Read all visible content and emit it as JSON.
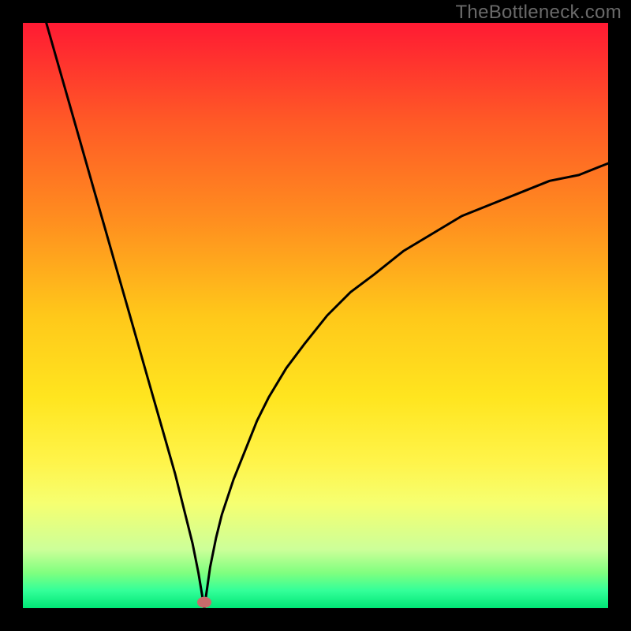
{
  "watermark": "TheBottleneck.com",
  "chart_data": {
    "type": "line",
    "title": "",
    "xlabel": "",
    "ylabel": "",
    "xlim": [
      0,
      100
    ],
    "ylim": [
      0,
      100
    ],
    "gradient_stops": [
      {
        "offset": 0.0,
        "color": "#ff1a33"
      },
      {
        "offset": 0.17,
        "color": "#ff5a26"
      },
      {
        "offset": 0.34,
        "color": "#ff8f1f"
      },
      {
        "offset": 0.5,
        "color": "#ffc81a"
      },
      {
        "offset": 0.64,
        "color": "#ffe51f"
      },
      {
        "offset": 0.75,
        "color": "#fff44a"
      },
      {
        "offset": 0.82,
        "color": "#f6ff70"
      },
      {
        "offset": 0.9,
        "color": "#ccff99"
      },
      {
        "offset": 0.94,
        "color": "#7fff7f"
      },
      {
        "offset": 0.97,
        "color": "#33ff99"
      },
      {
        "offset": 1.0,
        "color": "#00e676"
      }
    ],
    "optimum_point": {
      "x": 31,
      "y": 1
    },
    "optimum_marker_color": "#c96b6b",
    "series": [
      {
        "name": "bottleneck-curve",
        "x": [
          4,
          6,
          8,
          10,
          12,
          14,
          16,
          18,
          20,
          22,
          24,
          26,
          28,
          29,
          30,
          31,
          32,
          33,
          34,
          36,
          38,
          40,
          42,
          45,
          48,
          52,
          56,
          60,
          65,
          70,
          75,
          80,
          85,
          90,
          95,
          100
        ],
        "y": [
          100,
          93,
          86,
          79,
          72,
          65,
          58,
          51,
          44,
          37,
          30,
          23,
          15,
          11,
          6,
          0,
          7,
          12,
          16,
          22,
          27,
          32,
          36,
          41,
          45,
          50,
          54,
          57,
          61,
          64,
          67,
          69,
          71,
          73,
          74,
          76
        ]
      }
    ]
  }
}
